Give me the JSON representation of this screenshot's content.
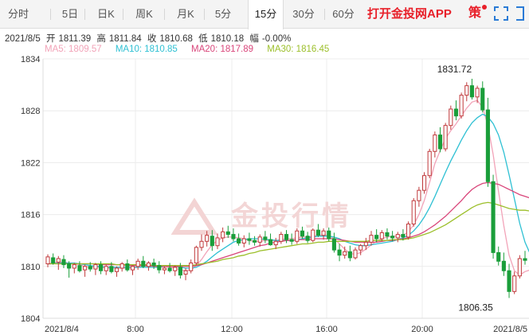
{
  "tabs": [
    {
      "label": "分时",
      "name": "tab-timeshare"
    },
    {
      "label": "5日",
      "name": "tab-5day"
    },
    {
      "label": "日K",
      "name": "tab-daily-k"
    },
    {
      "label": "周K",
      "name": "tab-weekly-k"
    },
    {
      "label": "月K",
      "name": "tab-monthly-k"
    },
    {
      "label": "5分",
      "name": "tab-5min"
    },
    {
      "label": "15分",
      "name": "tab-15min",
      "active": true
    },
    {
      "label": "30分",
      "name": "tab-30min"
    },
    {
      "label": "60分",
      "name": "tab-60min"
    }
  ],
  "toolbar": {
    "app_link": "打开金投网APP",
    "policy_label": "策",
    "fullscreen_icon": "fullscreen-icon",
    "close_icon": "close-bracket-icon"
  },
  "quote": {
    "date": "2021/8/5",
    "open_label": "开",
    "open": "1811.39",
    "high_label": "高",
    "high": "1811.84",
    "close_label": "收",
    "close": "1810.68",
    "low_label": "低",
    "low": "1810.18",
    "change_label": "幅",
    "change": "-0.00%"
  },
  "ma": [
    {
      "label": "MA5: 1809.57",
      "color": "#f2a3b8"
    },
    {
      "label": "MA10: 1810.85",
      "color": "#2ec0d3"
    },
    {
      "label": "MA20: 1817.89",
      "color": "#d9457a"
    },
    {
      "label": "MA30: 1816.45",
      "color": "#9cbf2a"
    }
  ],
  "watermark": "金投行情",
  "colors": {
    "up": "#c0393b",
    "down": "#1a9e3a",
    "grid": "#ececec"
  },
  "chart_data": {
    "type": "candlestick",
    "ylim": [
      1804,
      1834
    ],
    "y_ticks": [
      "1834",
      "1828",
      "1822",
      "1816",
      "1810",
      "1804"
    ],
    "x_ticks": [
      "2021/8/4",
      "8:00",
      "12:00",
      "16:00",
      "20:00",
      "2021/8/5"
    ],
    "annotations": [
      {
        "text": "1831.72",
        "price": 1831.72
      },
      {
        "text": "1806.35",
        "price": 1806.35
      }
    ],
    "candles": [
      [
        1810.3,
        1811.4,
        1809.9,
        1811.1
      ],
      [
        1811.0,
        1811.5,
        1810.2,
        1810.4
      ],
      [
        1810.5,
        1811.2,
        1809.6,
        1810.9
      ],
      [
        1810.8,
        1811.3,
        1809.8,
        1810.2
      ],
      [
        1810.3,
        1810.6,
        1808.7,
        1809.8
      ],
      [
        1809.8,
        1810.4,
        1809.2,
        1810.2
      ],
      [
        1810.1,
        1810.6,
        1809.3,
        1809.5
      ],
      [
        1809.6,
        1810.2,
        1808.8,
        1810.0
      ],
      [
        1810.0,
        1810.5,
        1809.4,
        1809.7
      ],
      [
        1809.7,
        1810.4,
        1809.0,
        1810.2
      ],
      [
        1810.2,
        1810.6,
        1809.1,
        1809.5
      ],
      [
        1809.5,
        1810.2,
        1809.0,
        1810.0
      ],
      [
        1810.0,
        1810.5,
        1809.2,
        1809.4
      ],
      [
        1809.4,
        1810.0,
        1808.8,
        1809.8
      ],
      [
        1809.8,
        1810.5,
        1809.4,
        1810.3
      ],
      [
        1810.3,
        1810.8,
        1809.4,
        1809.6
      ],
      [
        1809.6,
        1810.1,
        1809.0,
        1810.0
      ],
      [
        1810.0,
        1810.9,
        1809.6,
        1810.6
      ],
      [
        1810.6,
        1811.2,
        1809.8,
        1810.0
      ],
      [
        1810.0,
        1810.6,
        1809.5,
        1810.4
      ],
      [
        1810.4,
        1810.9,
        1809.7,
        1810.1
      ],
      [
        1810.1,
        1810.6,
        1809.2,
        1809.6
      ],
      [
        1809.6,
        1810.0,
        1809.1,
        1809.8
      ],
      [
        1809.8,
        1810.4,
        1809.3,
        1809.5
      ],
      [
        1809.5,
        1810.1,
        1808.9,
        1809.9
      ],
      [
        1809.9,
        1810.4,
        1808.6,
        1809.0
      ],
      [
        1809.1,
        1809.8,
        1808.4,
        1809.5
      ],
      [
        1809.5,
        1810.8,
        1809.2,
        1810.4
      ],
      [
        1810.4,
        1812.4,
        1810.1,
        1812.2
      ],
      [
        1812.2,
        1813.7,
        1811.8,
        1812.9
      ],
      [
        1812.9,
        1814.1,
        1812.3,
        1813.6
      ],
      [
        1813.5,
        1814.2,
        1811.8,
        1812.4
      ],
      [
        1812.4,
        1813.8,
        1812.0,
        1813.3
      ],
      [
        1813.3,
        1814.5,
        1812.8,
        1814.0
      ],
      [
        1814.0,
        1814.7,
        1813.3,
        1813.7
      ],
      [
        1813.7,
        1814.4,
        1812.9,
        1813.2
      ],
      [
        1813.2,
        1813.8,
        1812.4,
        1812.7
      ],
      [
        1812.7,
        1813.6,
        1812.2,
        1813.2
      ],
      [
        1813.2,
        1813.9,
        1812.5,
        1813.0
      ],
      [
        1813.0,
        1813.5,
        1812.4,
        1812.8
      ],
      [
        1812.8,
        1813.7,
        1812.3,
        1813.4
      ],
      [
        1813.4,
        1814.1,
        1812.7,
        1813.1
      ],
      [
        1813.1,
        1813.8,
        1812.4,
        1812.5
      ],
      [
        1812.5,
        1813.3,
        1812.0,
        1812.9
      ],
      [
        1812.9,
        1814.0,
        1812.6,
        1813.7
      ],
      [
        1813.7,
        1814.2,
        1812.7,
        1813.1
      ],
      [
        1813.1,
        1813.8,
        1812.5,
        1812.9
      ],
      [
        1812.9,
        1814.4,
        1812.6,
        1814.1
      ],
      [
        1814.1,
        1814.6,
        1813.2,
        1813.5
      ],
      [
        1813.5,
        1814.0,
        1812.7,
        1813.0
      ],
      [
        1813.0,
        1814.4,
        1812.8,
        1814.2
      ],
      [
        1814.2,
        1814.9,
        1813.4,
        1813.6
      ],
      [
        1813.6,
        1814.4,
        1813.1,
        1814.1
      ],
      [
        1814.1,
        1814.5,
        1812.9,
        1813.2
      ],
      [
        1813.2,
        1813.9,
        1811.6,
        1811.9
      ],
      [
        1811.9,
        1812.6,
        1810.6,
        1811.3
      ],
      [
        1811.3,
        1812.3,
        1810.9,
        1811.7
      ],
      [
        1811.7,
        1812.4,
        1810.6,
        1811.0
      ],
      [
        1811.0,
        1812.2,
        1810.8,
        1811.9
      ],
      [
        1811.9,
        1812.6,
        1811.3,
        1812.4
      ],
      [
        1812.4,
        1813.3,
        1811.9,
        1812.8
      ],
      [
        1812.8,
        1814.1,
        1812.4,
        1813.6
      ],
      [
        1813.6,
        1814.3,
        1812.8,
        1813.2
      ],
      [
        1813.2,
        1814.2,
        1812.9,
        1813.9
      ],
      [
        1813.9,
        1814.4,
        1813.1,
        1813.5
      ],
      [
        1813.5,
        1814.1,
        1812.9,
        1813.3
      ],
      [
        1813.3,
        1814.0,
        1812.8,
        1813.7
      ],
      [
        1813.7,
        1814.3,
        1813.0,
        1813.4
      ],
      [
        1813.4,
        1815.2,
        1813.1,
        1814.9
      ],
      [
        1814.9,
        1817.9,
        1814.6,
        1817.6
      ],
      [
        1817.6,
        1819.2,
        1816.9,
        1818.8
      ],
      [
        1818.8,
        1820.9,
        1818.4,
        1820.5
      ],
      [
        1820.5,
        1823.6,
        1820.2,
        1823.3
      ],
      [
        1823.3,
        1825.6,
        1822.6,
        1825.2
      ],
      [
        1825.2,
        1826.1,
        1823.2,
        1823.6
      ],
      [
        1823.6,
        1826.6,
        1823.3,
        1826.3
      ],
      [
        1826.3,
        1828.6,
        1825.8,
        1828.2
      ],
      [
        1828.2,
        1829.2,
        1826.9,
        1827.4
      ],
      [
        1827.4,
        1830.1,
        1827.1,
        1829.8
      ],
      [
        1829.8,
        1831.3,
        1829.1,
        1830.9
      ],
      [
        1830.9,
        1831.7,
        1829.3,
        1829.6
      ],
      [
        1829.6,
        1830.9,
        1828.9,
        1830.6
      ],
      [
        1830.6,
        1831.4,
        1827.8,
        1828.1
      ],
      [
        1828.1,
        1829.5,
        1819.2,
        1819.8
      ],
      [
        1819.8,
        1820.6,
        1810.9,
        1811.6
      ],
      [
        1811.6,
        1812.3,
        1810.1,
        1810.6
      ],
      [
        1810.6,
        1811.6,
        1808.9,
        1809.5
      ],
      [
        1809.5,
        1810.3,
        1806.35,
        1807.1
      ],
      [
        1807.1,
        1809.4,
        1806.8,
        1808.9
      ],
      [
        1808.9,
        1811.3,
        1808.6,
        1810.9
      ],
      [
        1810.9,
        1811.8,
        1810.2,
        1810.7
      ]
    ],
    "ma5": [
      1810.3,
      1810.4,
      1810.5,
      1810.5,
      1810.4,
      1810.3,
      1810.2,
      1810.0,
      1809.9,
      1809.9,
      1809.9,
      1809.8,
      1809.8,
      1809.8,
      1809.8,
      1809.8,
      1809.8,
      1809.9,
      1810.0,
      1810.1,
      1810.1,
      1810.1,
      1810.0,
      1809.9,
      1809.8,
      1809.6,
      1809.5,
      1809.6,
      1810.1,
      1810.8,
      1811.7,
      1812.5,
      1813.0,
      1813.3,
      1813.4,
      1813.4,
      1813.3,
      1813.2,
      1813.0,
      1812.9,
      1812.9,
      1813.0,
      1813.0,
      1813.0,
      1813.1,
      1813.2,
      1813.2,
      1813.3,
      1813.4,
      1813.4,
      1813.5,
      1813.6,
      1813.6,
      1813.6,
      1813.2,
      1812.6,
      1812.0,
      1811.5,
      1811.4,
      1811.6,
      1812.0,
      1812.5,
      1812.9,
      1813.2,
      1813.4,
      1813.5,
      1813.5,
      1813.6,
      1814.0,
      1814.8,
      1816.0,
      1817.6,
      1819.7,
      1821.9,
      1823.4,
      1824.8,
      1825.7,
      1826.5,
      1827.4,
      1828.3,
      1829.0,
      1829.2,
      1828.4,
      1826.3,
      1822.9,
      1818.7,
      1814.7,
      1811.3,
      1809.5,
      1809.0,
      1809.4,
      1809.6
    ],
    "ma10": [
      1810.3,
      1810.3,
      1810.4,
      1810.4,
      1810.4,
      1810.4,
      1810.3,
      1810.2,
      1810.1,
      1810.0,
      1810.0,
      1809.9,
      1809.9,
      1809.9,
      1809.9,
      1809.9,
      1809.9,
      1809.9,
      1809.9,
      1809.9,
      1809.9,
      1809.9,
      1810.0,
      1810.0,
      1810.0,
      1809.9,
      1809.8,
      1809.8,
      1809.9,
      1810.2,
      1810.6,
      1811.1,
      1811.6,
      1812.0,
      1812.4,
      1812.8,
      1813.0,
      1813.1,
      1813.2,
      1813.2,
      1813.2,
      1813.1,
      1813.1,
      1813.0,
      1813.0,
      1813.0,
      1813.0,
      1813.1,
      1813.2,
      1813.3,
      1813.4,
      1813.5,
      1813.5,
      1813.5,
      1813.4,
      1813.2,
      1812.9,
      1812.7,
      1812.5,
      1812.4,
      1812.4,
      1812.5,
      1812.6,
      1812.7,
      1812.8,
      1812.9,
      1813.1,
      1813.3,
      1813.6,
      1814.1,
      1814.8,
      1815.7,
      1816.8,
      1818.1,
      1819.5,
      1820.9,
      1822.2,
      1823.4,
      1824.6,
      1825.7,
      1826.6,
      1827.2,
      1827.6,
      1827.3,
      1826.5,
      1825.2,
      1823.2,
      1820.6,
      1817.8,
      1815.0,
      1812.8,
      1811.4
    ],
    "ma20": [
      1810.3,
      1810.3,
      1810.3,
      1810.3,
      1810.3,
      1810.3,
      1810.3,
      1810.3,
      1810.3,
      1810.3,
      1810.2,
      1810.2,
      1810.2,
      1810.2,
      1810.2,
      1810.1,
      1810.1,
      1810.1,
      1810.1,
      1810.1,
      1810.0,
      1810.0,
      1810.0,
      1810.0,
      1810.0,
      1810.0,
      1810.0,
      1810.0,
      1810.1,
      1810.2,
      1810.4,
      1810.6,
      1810.8,
      1811.0,
      1811.2,
      1811.4,
      1811.6,
      1811.8,
      1812.0,
      1812.2,
      1812.4,
      1812.5,
      1812.7,
      1812.8,
      1812.9,
      1813.0,
      1813.0,
      1813.1,
      1813.1,
      1813.1,
      1813.2,
      1813.2,
      1813.2,
      1813.2,
      1813.2,
      1813.1,
      1813.0,
      1812.9,
      1812.8,
      1812.8,
      1812.8,
      1812.8,
      1812.8,
      1812.9,
      1813.0,
      1813.0,
      1813.1,
      1813.2,
      1813.3,
      1813.5,
      1813.7,
      1814.0,
      1814.4,
      1814.8,
      1815.3,
      1815.8,
      1816.4,
      1817.0,
      1817.6,
      1818.3,
      1818.9,
      1819.3,
      1819.6,
      1819.7,
      1819.6,
      1819.5,
      1819.2,
      1818.9,
      1818.6,
      1818.3,
      1818.1,
      1817.9
    ],
    "ma30": [
      1810.3,
      1810.3,
      1810.3,
      1810.3,
      1810.3,
      1810.3,
      1810.3,
      1810.3,
      1810.3,
      1810.3,
      1810.3,
      1810.3,
      1810.3,
      1810.2,
      1810.2,
      1810.2,
      1810.2,
      1810.2,
      1810.2,
      1810.2,
      1810.1,
      1810.1,
      1810.1,
      1810.1,
      1810.1,
      1810.1,
      1810.1,
      1810.1,
      1810.2,
      1810.3,
      1810.4,
      1810.5,
      1810.6,
      1810.8,
      1810.9,
      1811.0,
      1811.2,
      1811.3,
      1811.5,
      1811.6,
      1811.8,
      1811.9,
      1812.0,
      1812.1,
      1812.2,
      1812.3,
      1812.4,
      1812.5,
      1812.6,
      1812.6,
      1812.7,
      1812.8,
      1812.8,
      1812.9,
      1812.9,
      1812.9,
      1812.9,
      1812.9,
      1812.9,
      1812.9,
      1812.9,
      1813.0,
      1813.0,
      1813.0,
      1813.0,
      1813.1,
      1813.1,
      1813.1,
      1813.2,
      1813.3,
      1813.5,
      1813.7,
      1813.9,
      1814.2,
      1814.5,
      1814.8,
      1815.2,
      1815.6,
      1816.0,
      1816.4,
      1816.8,
      1817.1,
      1817.3,
      1817.4,
      1817.3,
      1817.1,
      1816.9,
      1816.7,
      1816.6,
      1816.5,
      1816.5,
      1816.4
    ]
  }
}
